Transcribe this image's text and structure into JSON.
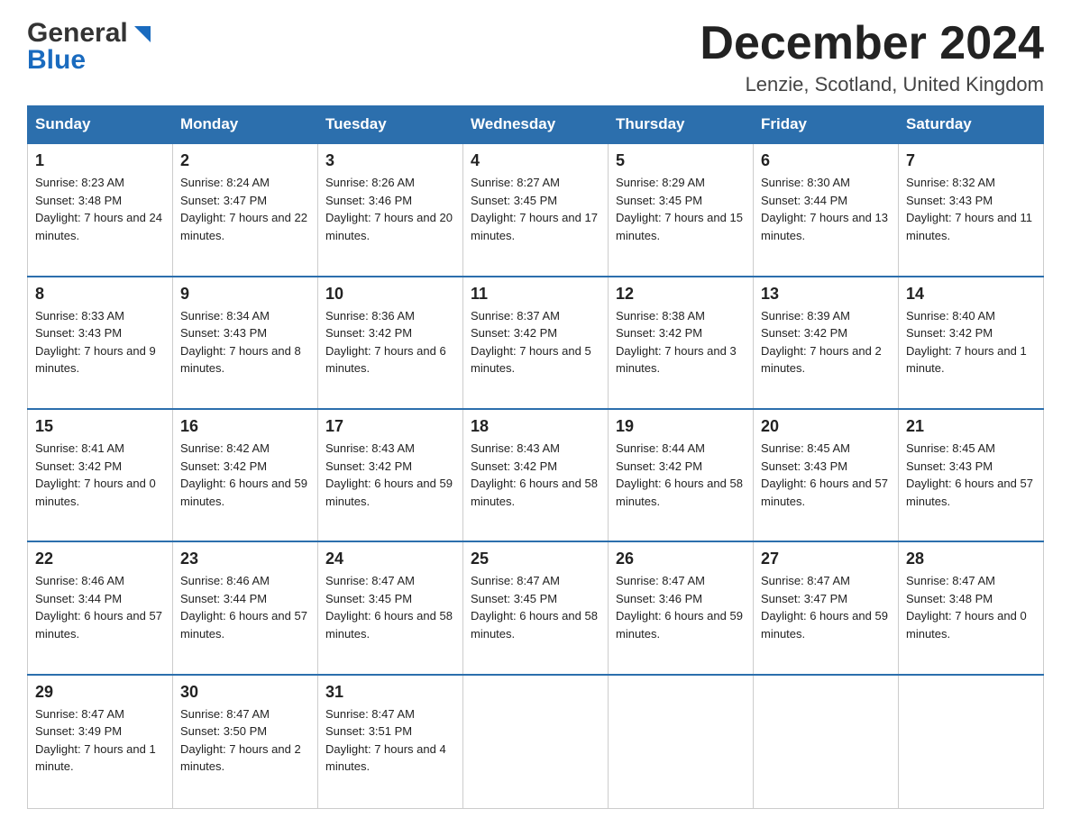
{
  "header": {
    "logo_line1": "General",
    "logo_line2": "Blue",
    "month_title": "December 2024",
    "location": "Lenzie, Scotland, United Kingdom"
  },
  "days_of_week": [
    "Sunday",
    "Monday",
    "Tuesday",
    "Wednesday",
    "Thursday",
    "Friday",
    "Saturday"
  ],
  "weeks": [
    [
      {
        "day": "1",
        "sunrise": "Sunrise: 8:23 AM",
        "sunset": "Sunset: 3:48 PM",
        "daylight": "Daylight: 7 hours and 24 minutes."
      },
      {
        "day": "2",
        "sunrise": "Sunrise: 8:24 AM",
        "sunset": "Sunset: 3:47 PM",
        "daylight": "Daylight: 7 hours and 22 minutes."
      },
      {
        "day": "3",
        "sunrise": "Sunrise: 8:26 AM",
        "sunset": "Sunset: 3:46 PM",
        "daylight": "Daylight: 7 hours and 20 minutes."
      },
      {
        "day": "4",
        "sunrise": "Sunrise: 8:27 AM",
        "sunset": "Sunset: 3:45 PM",
        "daylight": "Daylight: 7 hours and 17 minutes."
      },
      {
        "day": "5",
        "sunrise": "Sunrise: 8:29 AM",
        "sunset": "Sunset: 3:45 PM",
        "daylight": "Daylight: 7 hours and 15 minutes."
      },
      {
        "day": "6",
        "sunrise": "Sunrise: 8:30 AM",
        "sunset": "Sunset: 3:44 PM",
        "daylight": "Daylight: 7 hours and 13 minutes."
      },
      {
        "day": "7",
        "sunrise": "Sunrise: 8:32 AM",
        "sunset": "Sunset: 3:43 PM",
        "daylight": "Daylight: 7 hours and 11 minutes."
      }
    ],
    [
      {
        "day": "8",
        "sunrise": "Sunrise: 8:33 AM",
        "sunset": "Sunset: 3:43 PM",
        "daylight": "Daylight: 7 hours and 9 minutes."
      },
      {
        "day": "9",
        "sunrise": "Sunrise: 8:34 AM",
        "sunset": "Sunset: 3:43 PM",
        "daylight": "Daylight: 7 hours and 8 minutes."
      },
      {
        "day": "10",
        "sunrise": "Sunrise: 8:36 AM",
        "sunset": "Sunset: 3:42 PM",
        "daylight": "Daylight: 7 hours and 6 minutes."
      },
      {
        "day": "11",
        "sunrise": "Sunrise: 8:37 AM",
        "sunset": "Sunset: 3:42 PM",
        "daylight": "Daylight: 7 hours and 5 minutes."
      },
      {
        "day": "12",
        "sunrise": "Sunrise: 8:38 AM",
        "sunset": "Sunset: 3:42 PM",
        "daylight": "Daylight: 7 hours and 3 minutes."
      },
      {
        "day": "13",
        "sunrise": "Sunrise: 8:39 AM",
        "sunset": "Sunset: 3:42 PM",
        "daylight": "Daylight: 7 hours and 2 minutes."
      },
      {
        "day": "14",
        "sunrise": "Sunrise: 8:40 AM",
        "sunset": "Sunset: 3:42 PM",
        "daylight": "Daylight: 7 hours and 1 minute."
      }
    ],
    [
      {
        "day": "15",
        "sunrise": "Sunrise: 8:41 AM",
        "sunset": "Sunset: 3:42 PM",
        "daylight": "Daylight: 7 hours and 0 minutes."
      },
      {
        "day": "16",
        "sunrise": "Sunrise: 8:42 AM",
        "sunset": "Sunset: 3:42 PM",
        "daylight": "Daylight: 6 hours and 59 minutes."
      },
      {
        "day": "17",
        "sunrise": "Sunrise: 8:43 AM",
        "sunset": "Sunset: 3:42 PM",
        "daylight": "Daylight: 6 hours and 59 minutes."
      },
      {
        "day": "18",
        "sunrise": "Sunrise: 8:43 AM",
        "sunset": "Sunset: 3:42 PM",
        "daylight": "Daylight: 6 hours and 58 minutes."
      },
      {
        "day": "19",
        "sunrise": "Sunrise: 8:44 AM",
        "sunset": "Sunset: 3:42 PM",
        "daylight": "Daylight: 6 hours and 58 minutes."
      },
      {
        "day": "20",
        "sunrise": "Sunrise: 8:45 AM",
        "sunset": "Sunset: 3:43 PM",
        "daylight": "Daylight: 6 hours and 57 minutes."
      },
      {
        "day": "21",
        "sunrise": "Sunrise: 8:45 AM",
        "sunset": "Sunset: 3:43 PM",
        "daylight": "Daylight: 6 hours and 57 minutes."
      }
    ],
    [
      {
        "day": "22",
        "sunrise": "Sunrise: 8:46 AM",
        "sunset": "Sunset: 3:44 PM",
        "daylight": "Daylight: 6 hours and 57 minutes."
      },
      {
        "day": "23",
        "sunrise": "Sunrise: 8:46 AM",
        "sunset": "Sunset: 3:44 PM",
        "daylight": "Daylight: 6 hours and 57 minutes."
      },
      {
        "day": "24",
        "sunrise": "Sunrise: 8:47 AM",
        "sunset": "Sunset: 3:45 PM",
        "daylight": "Daylight: 6 hours and 58 minutes."
      },
      {
        "day": "25",
        "sunrise": "Sunrise: 8:47 AM",
        "sunset": "Sunset: 3:45 PM",
        "daylight": "Daylight: 6 hours and 58 minutes."
      },
      {
        "day": "26",
        "sunrise": "Sunrise: 8:47 AM",
        "sunset": "Sunset: 3:46 PM",
        "daylight": "Daylight: 6 hours and 59 minutes."
      },
      {
        "day": "27",
        "sunrise": "Sunrise: 8:47 AM",
        "sunset": "Sunset: 3:47 PM",
        "daylight": "Daylight: 6 hours and 59 minutes."
      },
      {
        "day": "28",
        "sunrise": "Sunrise: 8:47 AM",
        "sunset": "Sunset: 3:48 PM",
        "daylight": "Daylight: 7 hours and 0 minutes."
      }
    ],
    [
      {
        "day": "29",
        "sunrise": "Sunrise: 8:47 AM",
        "sunset": "Sunset: 3:49 PM",
        "daylight": "Daylight: 7 hours and 1 minute."
      },
      {
        "day": "30",
        "sunrise": "Sunrise: 8:47 AM",
        "sunset": "Sunset: 3:50 PM",
        "daylight": "Daylight: 7 hours and 2 minutes."
      },
      {
        "day": "31",
        "sunrise": "Sunrise: 8:47 AM",
        "sunset": "Sunset: 3:51 PM",
        "daylight": "Daylight: 7 hours and 4 minutes."
      },
      null,
      null,
      null,
      null
    ]
  ]
}
